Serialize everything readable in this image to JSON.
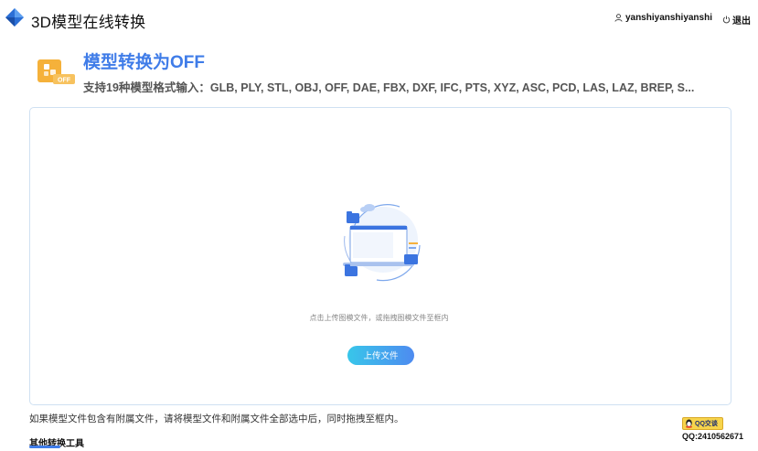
{
  "header": {
    "app_title": "3D模型在线转换",
    "username": "yanshiyanshiyanshi",
    "logout_label": "退出"
  },
  "hero": {
    "icon_badge": "OFF",
    "title": "模型转换为OFF",
    "subtitle": "支持19种模型格式输入：GLB, PLY, STL, OBJ, OFF, DAE, FBX, DXF, IFC, PTS, XYZ, ASC, PCD, LAS, LAZ, BREP, S..."
  },
  "dropzone": {
    "hint": "点击上传图模文件，或拖拽图模文件至框内",
    "upload_label": "上传文件"
  },
  "note": "如果模型文件包含有附属文件，请将模型文件和附属文件全部选中后，同时拖拽至框内。",
  "other_tools_label": "其他转换工具",
  "contact": {
    "qq_badge": "QQ交谈",
    "qq_number": "QQ:2410562671"
  },
  "colors": {
    "accent": "#3f7ce8",
    "button_gradient_start": "#38c6ea",
    "button_gradient_end": "#4e8bf0",
    "icon_orange": "#f5b13a"
  }
}
